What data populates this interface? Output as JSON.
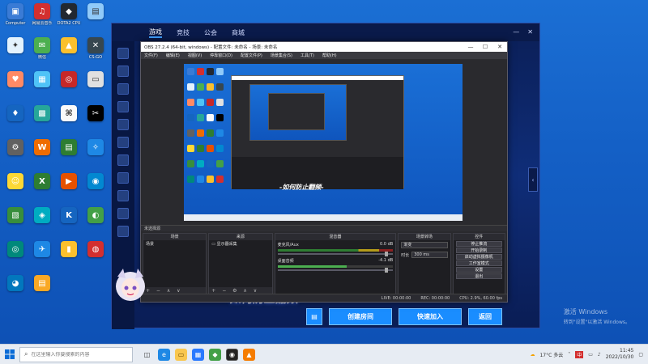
{
  "desktop": {
    "icons": [
      {
        "label": "Computer",
        "color": "#3a7bd5",
        "glyph": "▣"
      },
      {
        "label": "网易云音乐",
        "color": "#d32f2f",
        "glyph": "♫"
      },
      {
        "label": "DOTA2 CPU",
        "color": "#222831",
        "glyph": "◆"
      },
      {
        "label": "",
        "color": "#90caf9",
        "glyph": "▤"
      },
      {
        "label": "",
        "color": "#e3f2fd",
        "glyph": "✦"
      },
      {
        "label": "微信",
        "color": "#4caf50",
        "glyph": "✉"
      },
      {
        "label": "",
        "color": "#fbc02d",
        "glyph": "▲"
      },
      {
        "label": "CS:GO",
        "color": "#37474f",
        "glyph": "✕"
      },
      {
        "label": "",
        "color": "#ff8a65",
        "glyph": "♥"
      },
      {
        "label": "",
        "color": "#4fc3f7",
        "glyph": "▦"
      },
      {
        "label": "",
        "color": "#c62828",
        "glyph": "◎"
      },
      {
        "label": "",
        "color": "#e0e0e0",
        "glyph": "▭"
      },
      {
        "label": "",
        "color": "#1565c0",
        "glyph": "♦"
      },
      {
        "label": "",
        "color": "#26a69a",
        "glyph": "▩"
      },
      {
        "label": "",
        "color": "#fafafa",
        "glyph": "⌘"
      },
      {
        "label": "",
        "color": "#000000",
        "glyph": "✂"
      },
      {
        "label": "",
        "color": "#616161",
        "glyph": "⚙"
      },
      {
        "label": "",
        "color": "#ef6c00",
        "glyph": "W"
      },
      {
        "label": "",
        "color": "#2e7d32",
        "glyph": "▤"
      },
      {
        "label": "",
        "color": "#1e88e5",
        "glyph": "✧"
      },
      {
        "label": "",
        "color": "#fdd835",
        "glyph": "☺"
      },
      {
        "label": "",
        "color": "#2e7d32",
        "glyph": "X"
      },
      {
        "label": "",
        "color": "#e65100",
        "glyph": "▶"
      },
      {
        "label": "",
        "color": "#0288d1",
        "glyph": "◉"
      },
      {
        "label": "",
        "color": "#388e3c",
        "glyph": "▧"
      },
      {
        "label": "",
        "color": "#00acc1",
        "glyph": "◈"
      },
      {
        "label": "",
        "color": "#1565c0",
        "glyph": "K"
      },
      {
        "label": "",
        "color": "#43a047",
        "glyph": "◐"
      },
      {
        "label": "",
        "color": "#00897b",
        "glyph": "◎"
      },
      {
        "label": "",
        "color": "#1e88e5",
        "glyph": "✈"
      },
      {
        "label": "",
        "color": "#fbc02d",
        "glyph": "▮"
      },
      {
        "label": "",
        "color": "#d32f2f",
        "glyph": "◍"
      },
      {
        "label": "",
        "color": "#0277bd",
        "glyph": "◕"
      },
      {
        "label": "",
        "color": "#f9a825",
        "glyph": "▤"
      }
    ]
  },
  "launcher": {
    "tabs": [
      "游戏",
      "竞技",
      "公会",
      "商城"
    ],
    "title_overlay": "-如何防止翻频-",
    "buttons": {
      "create_room": "创建房间",
      "quick_join": "快速加入",
      "back": "返回"
    },
    "scroll_glyph": "‹"
  },
  "obs": {
    "title": "OBS 27.2.4 (64-bit, windows) - 配置文件: 未命名 - 场景: 未命名",
    "menu": [
      "文件(F)",
      "编辑(E)",
      "视图(V)",
      "停靠窗口(D)",
      "配置文件(P)",
      "场景集合(S)",
      "工具(T)",
      "帮助(H)"
    ],
    "dock_bar": "未选择源",
    "docks": {
      "scenes": {
        "title": "场景",
        "items": [
          "场景"
        ]
      },
      "sources": {
        "title": "来源",
        "items": [
          "显示器采集"
        ]
      },
      "mixer": {
        "title": "混音器",
        "channels": [
          {
            "name": "麦克风/Aux",
            "db": "0.0 dB"
          },
          {
            "name": "桌面音频",
            "db": "-4.1 dB"
          }
        ]
      },
      "transitions": {
        "title": "场景转场",
        "type": "渐变",
        "duration_label": "时长",
        "duration": "300 ms"
      },
      "controls": {
        "title": "控件",
        "buttons": [
          "停止推流",
          "开始录制",
          "启动虚拟摄像机",
          "工作室模式",
          "设置",
          "退出"
        ]
      }
    },
    "status": {
      "live": "LIVE: 00:00:00",
      "rec": "REC: 00:00:00",
      "cpu": "CPU: 2.9%, 60.00 fps"
    },
    "nested_title": "-如何防止翻频-"
  },
  "watermark": {
    "line1": "激活 Windows",
    "line2": "转到\"设置\"以激活 Windows。"
  },
  "taskbar": {
    "search_placeholder": "在这里输入你要搜索的内容",
    "weather": "17°C 多云",
    "time": "11:45",
    "date": "2022/10/30",
    "ime": "中"
  }
}
